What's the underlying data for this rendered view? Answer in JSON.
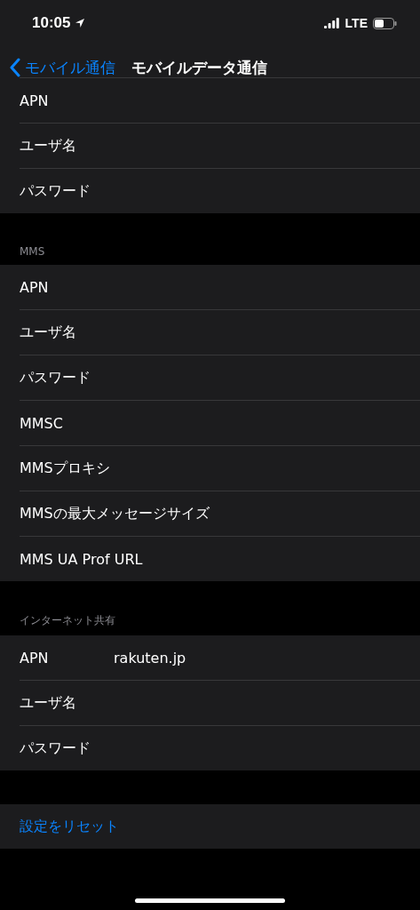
{
  "status_bar": {
    "time": "10:05",
    "network": "LTE"
  },
  "nav": {
    "back": "モバイル通信",
    "title": "モバイルデータ通信"
  },
  "sections": [
    {
      "rows": [
        {
          "label": "APN"
        },
        {
          "label": "ユーザ名"
        },
        {
          "label": "パスワード"
        }
      ]
    },
    {
      "header": "MMS",
      "rows": [
        {
          "label": "APN"
        },
        {
          "label": "ユーザ名"
        },
        {
          "label": "パスワード"
        },
        {
          "label": "MMSC"
        },
        {
          "label": "MMSプロキシ"
        },
        {
          "label": "MMSの最大メッセージサイズ"
        },
        {
          "label": "MMS UA Prof URL"
        }
      ]
    },
    {
      "header": "インターネット共有",
      "rows": [
        {
          "label": "APN",
          "value": "rakuten.jp"
        },
        {
          "label": "ユーザ名"
        },
        {
          "label": "パスワード"
        }
      ]
    }
  ],
  "reset": "設定をリセット"
}
